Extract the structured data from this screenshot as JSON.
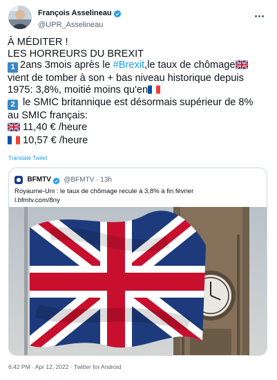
{
  "author": {
    "display_name": "François Asselineau",
    "handle": "@UPR_Asselineau"
  },
  "tweet": {
    "line1": "À MÉDITER !",
    "line2": "LES HORREURS DU BREXIT",
    "p1_key": "1",
    "p1_before_hashtag": "2ans 3mois après le ",
    "hashtag": "#Brexit",
    "p1_after_hashtag": ",le taux de chômage",
    "p1_line2": "vient de tomber à son + bas niveau historique depuis",
    "p1_line3": "1975: 3,8%, moitié moins qu'en",
    "p2_key": "2",
    "p2_line1": " le SMIC britannique est désormais supérieur de 8%",
    "p2_line2": "au SMIC français:",
    "uk_wage": " 11,40 € /heure",
    "fr_wage": " 10,57 € /heure"
  },
  "translate_label": "Translate Tweet",
  "quoted": {
    "name": "BFMTV",
    "handle": "@BFMTV",
    "separator": " · ",
    "time": "13h",
    "text_line1": "Royaume-Uni : le taux de chômage recule à 3,8% à fin février",
    "text_line2": "l.bfmtv.com/8ny"
  },
  "footer": {
    "time": "6:42 PM",
    "separator": " · ",
    "date": "Apr 12, 2022",
    "source": "Twitter for Android"
  },
  "icons": {
    "verified": "verified-badge-icon",
    "more": "more-options-icon",
    "keycap": "keycap-digit-icon",
    "uk_flag": "uk-flag-icon",
    "fr_flag": "france-flag-icon"
  },
  "colors": {
    "link_blue": "#1d9bf0",
    "secondary_text": "#536471",
    "border": "#cfd9de"
  }
}
